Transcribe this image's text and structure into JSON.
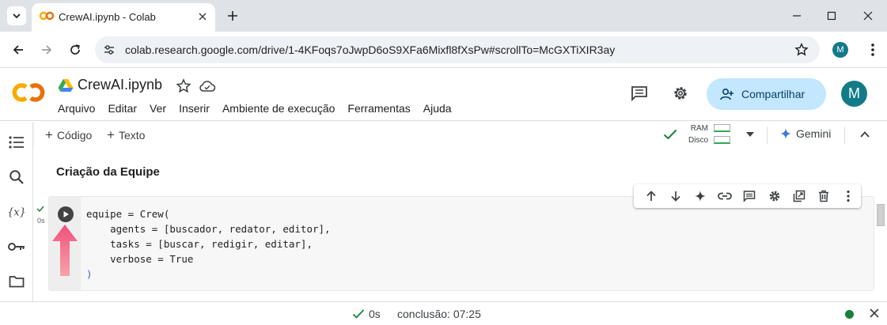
{
  "browser": {
    "tab_title": "CrewAI.ipynb - Colab",
    "url": "colab.research.google.com/drive/1-4KFoqs7oJwpD6oS9XFa6Mixfl8fXsPw#scrollTo=McGXTiXIR3ay",
    "profile_initial": "M"
  },
  "colab": {
    "notebook_title": "CrewAI.ipynb",
    "menu": [
      "Arquivo",
      "Editar",
      "Ver",
      "Inserir",
      "Ambiente de execução",
      "Ferramentas",
      "Ajuda"
    ],
    "share_label": "Compartilhar",
    "avatar_initial": "M"
  },
  "notebook_toolbar": {
    "add_code": "Código",
    "add_text": "Texto",
    "ram_label": "RAM",
    "disk_label": "Disco",
    "gemini_label": "Gemini"
  },
  "content": {
    "section_title": "Criação da Equipe",
    "cell": {
      "exec_time": "0s",
      "code_lines": [
        "equipe = Crew(",
        "    agents = [buscador, redator, editor],",
        "    tasks = [buscar, redigir, editar],",
        "    verbose = True",
        ")"
      ]
    }
  },
  "status_bar": {
    "elapsed": "0s",
    "completion": "conclusão: 07:25"
  },
  "colors": {
    "accent_share": "#c2e7ff",
    "avatar": "#127b8a",
    "arrow": "#f0507c",
    "status_ok": "#188038",
    "keyword": "#1a47c7"
  },
  "icons": {
    "sidebar": [
      "toc-icon",
      "search-icon",
      "variables-icon",
      "key-icon",
      "folder-icon"
    ],
    "cell_toolbar": [
      "move-up-icon",
      "move-down-icon",
      "gemini-sparkle-icon",
      "link-icon",
      "comment-icon",
      "settings-icon",
      "mirror-cell-icon",
      "delete-icon",
      "more-vert-icon"
    ]
  }
}
